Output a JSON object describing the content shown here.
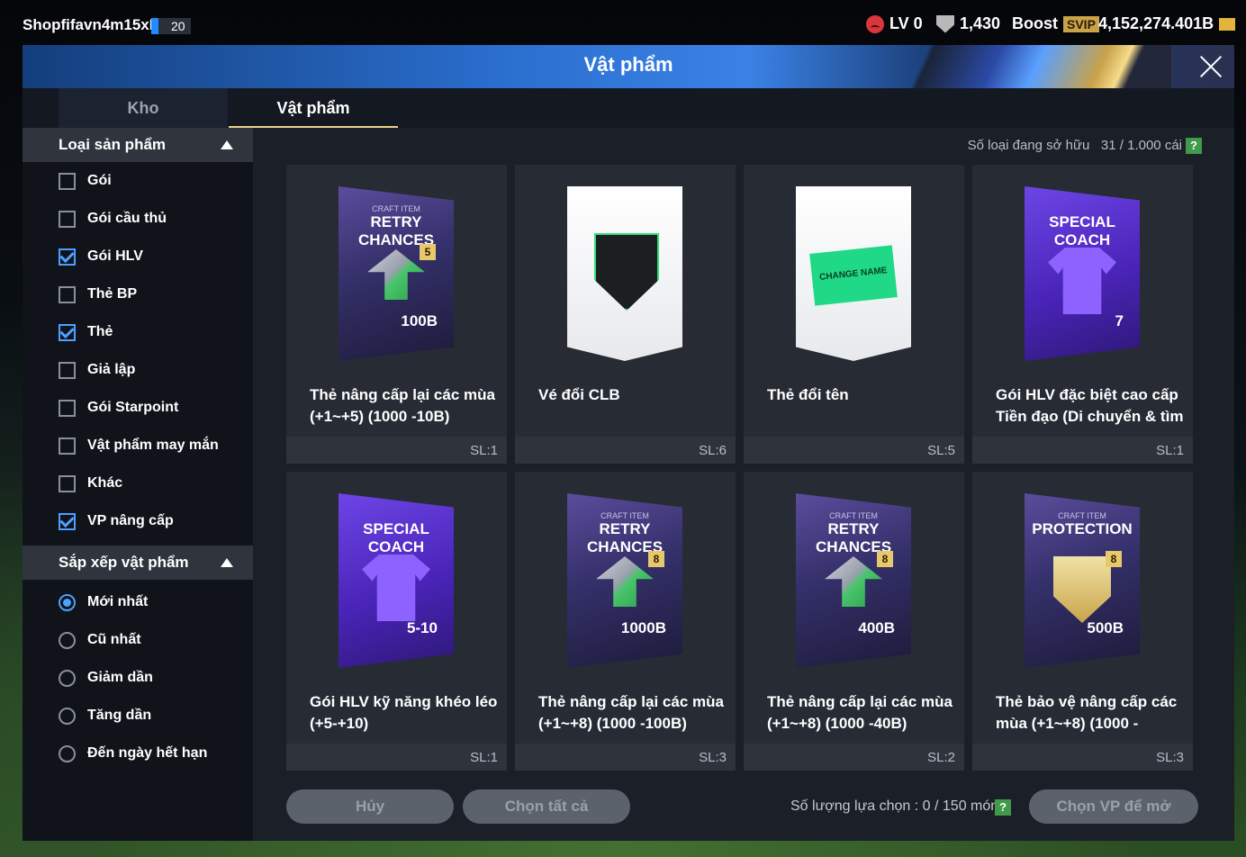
{
  "topbar": {
    "username": "Shopfifavn4m15xB",
    "level_badge": "20",
    "lv": "LV 0",
    "trophies": "1,430",
    "boost_label": "Boost",
    "svip": "SVIP",
    "balance": "4,152,274.401B"
  },
  "modal": {
    "title": "Vật phẩm",
    "tabs": [
      "Kho",
      "Vật phẩm"
    ],
    "active_tab": "Vật phẩm"
  },
  "sidebar": {
    "filter_title": "Loại sản phẩm",
    "filters": [
      {
        "label": "Gói",
        "checked": false
      },
      {
        "label": "Gói cầu thủ",
        "checked": false
      },
      {
        "label": "Gói HLV",
        "checked": true
      },
      {
        "label": "Thẻ BP",
        "checked": false
      },
      {
        "label": "Thẻ",
        "checked": true
      },
      {
        "label": "Giả lập",
        "checked": false
      },
      {
        "label": "Gói Starpoint",
        "checked": false
      },
      {
        "label": "Vật phẩm may mắn",
        "checked": false
      },
      {
        "label": "Khác",
        "checked": false
      },
      {
        "label": "VP nâng cấp",
        "checked": true
      }
    ],
    "sort_title": "Sắp xếp vật phẩm",
    "sorts": [
      {
        "label": "Mới nhất",
        "selected": true
      },
      {
        "label": "Cũ nhất",
        "selected": false
      },
      {
        "label": "Giảm dần",
        "selected": false
      },
      {
        "label": "Tăng dần",
        "selected": false
      },
      {
        "label": "Đến ngày hết hạn",
        "selected": false
      }
    ]
  },
  "owned": {
    "label": "Số loại đang sở hữu",
    "value": "31 / 1.000 cái"
  },
  "items": [
    {
      "name": "Thẻ nâng cấp lại các mùa (+1~+5) (1000 -10B)",
      "qty": "SL:1",
      "art": "dark",
      "top": "CRAFT ITEM",
      "main": "RETRY CHANCES",
      "badge": "5",
      "value": "100B"
    },
    {
      "name": "Vé đổi CLB",
      "qty": "SL:6",
      "art": "white-fc"
    },
    {
      "name": "Thẻ đổi tên",
      "qty": "SL:5",
      "art": "white-name",
      "main": "CHANGE NAME"
    },
    {
      "name": "Gói HLV đặc biệt cao cấp Tiền đạo (Di chuyển & tìm",
      "qty": "SL:1",
      "art": "coach",
      "main": "SPECIAL COACH",
      "value": "7"
    },
    {
      "name": "Gói HLV kỹ năng khéo léo (+5-+10)",
      "qty": "SL:1",
      "art": "coach",
      "main": "SPECIAL COACH",
      "value": "5-10"
    },
    {
      "name": "Thẻ nâng cấp lại các mùa (+1~+8) (1000 -100B)",
      "qty": "SL:3",
      "art": "dark",
      "top": "CRAFT ITEM",
      "main": "RETRY CHANCES",
      "badge": "8",
      "value": "1000B"
    },
    {
      "name": "Thẻ nâng cấp lại các mùa (+1~+8) (1000 -40B)",
      "qty": "SL:2",
      "art": "dark",
      "top": "CRAFT ITEM",
      "main": "RETRY CHANCES",
      "badge": "8",
      "value": "400B"
    },
    {
      "name": "Thẻ bảo vệ nâng cấp các mùa (+1~+8) (1000 -",
      "qty": "SL:3",
      "art": "shield",
      "top": "CRAFT ITEM",
      "main": "PROTECTION",
      "badge": "8",
      "value": "500B"
    }
  ],
  "bottom": {
    "cancel": "Hủy",
    "select_all": "Chọn tất cả",
    "selection_count": "Số lượng lựa chọn : 0 / 150 món",
    "open": "Chọn VP để mở",
    "help": "?"
  }
}
